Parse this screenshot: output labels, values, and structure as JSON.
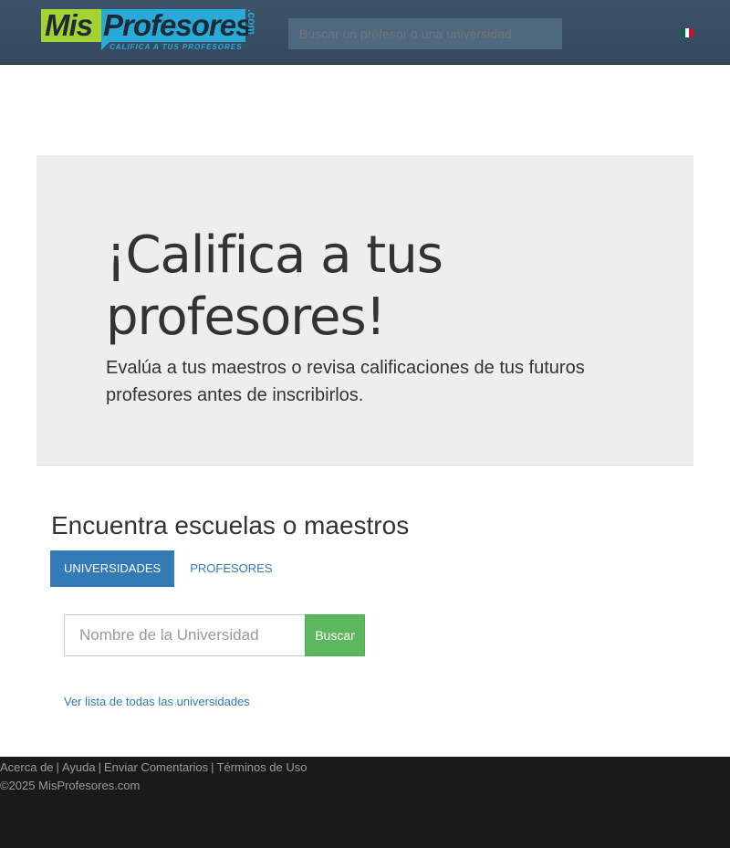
{
  "header": {
    "logo": {
      "part1": "Mis",
      "part2": "Profesores",
      "suffix": ".com",
      "tagline": "CALIFICA A TUS PROFESORES"
    },
    "search_placeholder": "Buscar un profesor o una universidad",
    "flag": "mexico-flag-icon"
  },
  "hero": {
    "title": "¡Califica a tus profesores!",
    "subtitle": "Evalúa a tus maestros o revisa calificaciones de tus futuros profesores antes de inscribirlos."
  },
  "search": {
    "title": "Encuentra escuelas o maestros",
    "tabs": [
      {
        "label": "UNIVERSIDADES",
        "active": true
      },
      {
        "label": "PROFESORES",
        "active": false
      }
    ],
    "input_placeholder": "Nombre de la Universidad",
    "button_label": "Buscar",
    "list_link": "Ver lista de todas las universidades"
  },
  "footer": {
    "links": [
      "Acerca de",
      "Ayuda",
      "Enviar Comentarios",
      "Términos de Uso"
    ],
    "copyright": "©2025 MisProfesores.com"
  },
  "colors": {
    "header": "#34495e",
    "primary": "#337ab7",
    "success": "#5cb85c",
    "logo_green": "#a4d233",
    "logo_blue": "#29a9d8",
    "footer": "#1a1a1a"
  }
}
